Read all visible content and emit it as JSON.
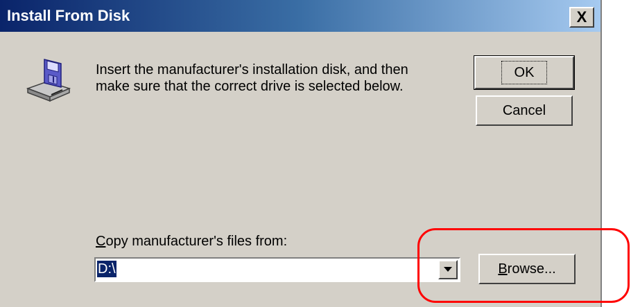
{
  "window": {
    "title": "Install From Disk",
    "close_label": "X"
  },
  "icons": {
    "disk": "floppy-disk-drive-icon",
    "close": "close-icon",
    "dropdown": "chevron-down-icon"
  },
  "message": {
    "line1": "Insert the manufacturer's installation disk, and then",
    "line2": "make sure that the correct drive is selected below."
  },
  "buttons": {
    "ok": "OK",
    "cancel": "Cancel",
    "browse": "Browse..."
  },
  "copy_from": {
    "label_prefix": "C",
    "label_rest": "opy manufacturer's files from:",
    "value": "D:\\"
  },
  "colors": {
    "dialog_bg": "#d4d0c8",
    "title_start": "#0a246a",
    "title_end": "#a6caf0",
    "selection": "#0a246a",
    "annotation": "#ff0000"
  }
}
